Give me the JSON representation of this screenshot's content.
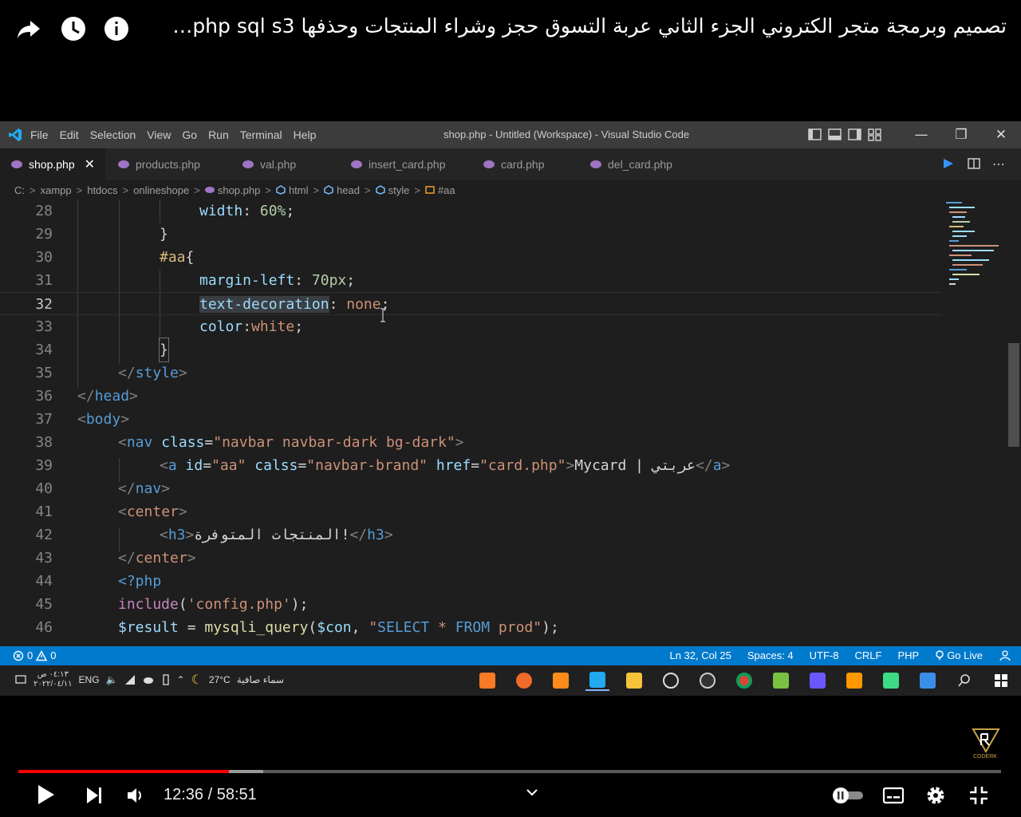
{
  "youtube": {
    "title": "تصميم وبرمجة متجر الكتروني الجزء الثاني عربة التسوق حجز وشراء المنتجات وحذفها php sql s3…",
    "time_current": "12:36",
    "time_sep": " / ",
    "time_total": "58:51",
    "progress_played": 0.214,
    "progress_buffered": 0.249,
    "watermark_text": "CODERK"
  },
  "vscode": {
    "menu": [
      "File",
      "Edit",
      "Selection",
      "View",
      "Go",
      "Run",
      "Terminal",
      "Help"
    ],
    "window_title": "shop.php - Untitled (Workspace) - Visual Studio Code",
    "tabs": [
      {
        "label": "shop.php",
        "active": true
      },
      {
        "label": "products.php",
        "active": false
      },
      {
        "label": "val.php",
        "active": false
      },
      {
        "label": "insert_card.php",
        "active": false
      },
      {
        "label": "card.php",
        "active": false
      },
      {
        "label": "del_card.php",
        "active": false
      }
    ],
    "breadcrumb": [
      "C:",
      "xampp",
      "htdocs",
      "onlineshope",
      "shop.php",
      "html",
      "head",
      "style",
      "#aa"
    ],
    "line_numbers": [
      "28",
      "29",
      "30",
      "31",
      "32",
      "33",
      "34",
      "35",
      "36",
      "37",
      "38",
      "39",
      "40",
      "41",
      "42",
      "43",
      "44",
      "45",
      "46"
    ],
    "code": {
      "l28_prop": "width",
      "l28_val": "60%",
      "l29": "}",
      "l30_sel": "#aa",
      "l30_brace": "{",
      "l31_prop": "margin-left",
      "l31_val": "70px",
      "l32_prop": "text-decoration",
      "l32_val": "none",
      "l33_prop": "color",
      "l33_val": "white",
      "l34": "}",
      "l35_tag": "style",
      "l36_tag": "head",
      "l37_tag": "body",
      "l38_tag": "nav",
      "l38_attr": "class",
      "l38_str": "\"navbar navbar-dark bg-dark\"",
      "l39_tag": "a",
      "l39_attr1": "id",
      "l39_str1": "\"aa\"",
      "l39_attr2": "calss",
      "l39_str2": "\"navbar-brand\"",
      "l39_attr3": "href",
      "l39_str3": "\"card.php\"",
      "l39_text": "Mycard | عربتي",
      "l40_tag": "nav",
      "l41_tag": "center",
      "l42_tag": "h3",
      "l42_text": "المنتجات المتوفرة!",
      "l43_tag": "center",
      "l44": "<?php",
      "l45_fn": "include",
      "l45_str": "'config.php'",
      "l46_var": "$result",
      "l46_fn": "mysqli_query",
      "l46_var2": "$con",
      "l46_sql1": "SELECT",
      "l46_sql2": "FROM",
      "l46_tbl": "prod"
    },
    "status_left": {
      "errors": "0",
      "warnings": "0"
    },
    "status_right": [
      "Ln 32, Col 25",
      "Spaces: 4",
      "UTF-8",
      "CRLF",
      "PHP",
      "Go Live"
    ]
  },
  "taskbar": {
    "clock_time": "٠٤:١٣ ص",
    "clock_date": "٢٠٢٢/٠٤/١١",
    "lang": "ENG",
    "temperature": "27°C",
    "weather": "سماء صافية"
  },
  "colors": {
    "status_bar": "#007acc",
    "progress_played": "#ff0000",
    "editor_bg": "#1e1e1e"
  }
}
